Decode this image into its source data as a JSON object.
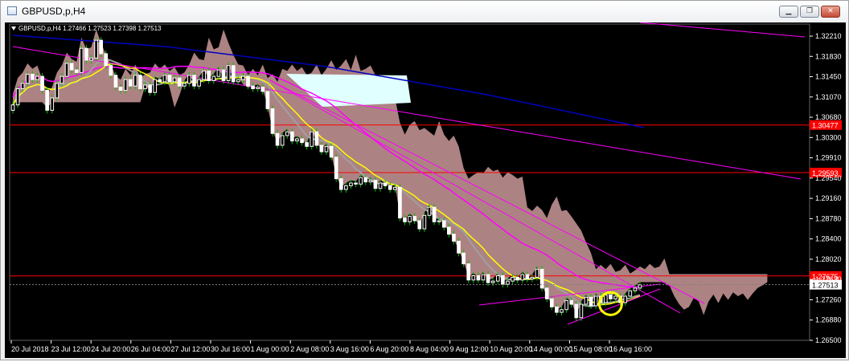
{
  "window": {
    "title": "GBPUSD,p,H4",
    "buttons": [
      "minimize",
      "restore",
      "close"
    ]
  },
  "colors": {
    "background": "#000000",
    "bull_candle": "#ffffff",
    "bear_candle": "#ffffff",
    "wick": "#00c000",
    "cloud": "#c09090",
    "cloud_bullish": "#e0ffff",
    "sma_fast": "#ffff00",
    "kijun": "#a0a0a0",
    "ema_slow": "#ff00ff",
    "ma_blue": "#0000c0",
    "hline": "#ff0000",
    "marker_circle": "#ffff00"
  },
  "chart_data": {
    "type": "candlestick",
    "symbol": "GBPUSD",
    "timeframe": "H4",
    "header": "GBPUSD,p,H4  1.27466 1.27523 1.27398 1.27513",
    "ylim": [
      1.2648,
      1.3235
    ],
    "y_ticks": [
      "1.32210",
      "1.31830",
      "1.31450",
      "1.31070",
      "1.30680",
      "1.30300",
      "1.29910",
      "1.29540",
      "1.29160",
      "1.28780",
      "1.28400",
      "1.28020",
      "1.27630",
      "1.27260",
      "1.26880",
      "1.26500"
    ],
    "x_ticks": [
      "20 Jul 2018",
      "23 Jul 12:00",
      "24 Jul 20:00",
      "26 Jul 04:00",
      "27 Jul 12:00",
      "30 Jul 16:00",
      "1 Aug 00:00",
      "2 Aug 08:00",
      "3 Aug 16:00",
      "6 Aug 20:00",
      "8 Aug 04:00",
      "9 Aug 12:00",
      "10 Aug 20:00",
      "14 Aug 00:00",
      "15 Aug 08:00",
      "16 Aug 16:00"
    ],
    "horizontal_lines": [
      {
        "price": 1.30477,
        "label": "1.30477"
      },
      {
        "price": 1.29593,
        "label": "1.29593"
      },
      {
        "price": 1.27675,
        "label": "1.27675"
      }
    ],
    "current_price": {
      "price": 1.27513,
      "label": "1.27513"
    },
    "closes": [
      1.3085,
      1.3115,
      1.3125,
      1.3142,
      1.3132,
      1.3138,
      1.3112,
      1.3075,
      1.3098,
      1.3125,
      1.3138,
      1.3162,
      1.315,
      1.3145,
      1.319,
      1.3168,
      1.3172,
      1.3205,
      1.318,
      1.3158,
      1.314,
      1.3118,
      1.3112,
      1.3132,
      1.312,
      1.314,
      1.3115,
      1.3122,
      1.3108,
      1.3132,
      1.3128,
      1.314,
      1.3128,
      1.3135,
      1.312,
      1.3125,
      1.314,
      1.312,
      1.3132,
      1.3148,
      1.313,
      1.3138,
      1.315,
      1.313,
      1.3158,
      1.3128,
      1.3132,
      1.3138,
      1.312,
      1.3115,
      1.3118,
      1.311,
      1.3078,
      1.3032,
      1.301,
      1.3028,
      1.3035,
      1.3018,
      1.3022,
      1.3015,
      1.3008,
      1.3035,
      1.301,
      1.2998,
      1.3008,
      1.2988,
      1.2948,
      1.2928,
      1.2935,
      1.294,
      1.2938,
      1.295,
      1.2942,
      1.2945,
      1.293,
      1.294,
      1.2935,
      1.2928,
      1.2932,
      1.2875,
      1.2868,
      1.2878,
      1.287,
      1.2855,
      1.288,
      1.2895,
      1.2868,
      1.287,
      1.2858,
      1.2845,
      1.2832,
      1.281,
      1.279,
      1.276,
      1.2768,
      1.276,
      1.277,
      1.2755,
      1.2758,
      1.2768,
      1.2752,
      1.2758,
      1.2765,
      1.276,
      1.277,
      1.2762,
      1.2765,
      1.278,
      1.2745,
      1.2725,
      1.271,
      1.27,
      1.2705,
      1.2722,
      1.2715,
      1.269,
      1.2715,
      1.2728,
      1.2712,
      1.273,
      1.2718,
      1.2732,
      1.2725,
      1.273,
      1.2718,
      1.273,
      1.274,
      1.2745,
      1.2751
    ]
  }
}
